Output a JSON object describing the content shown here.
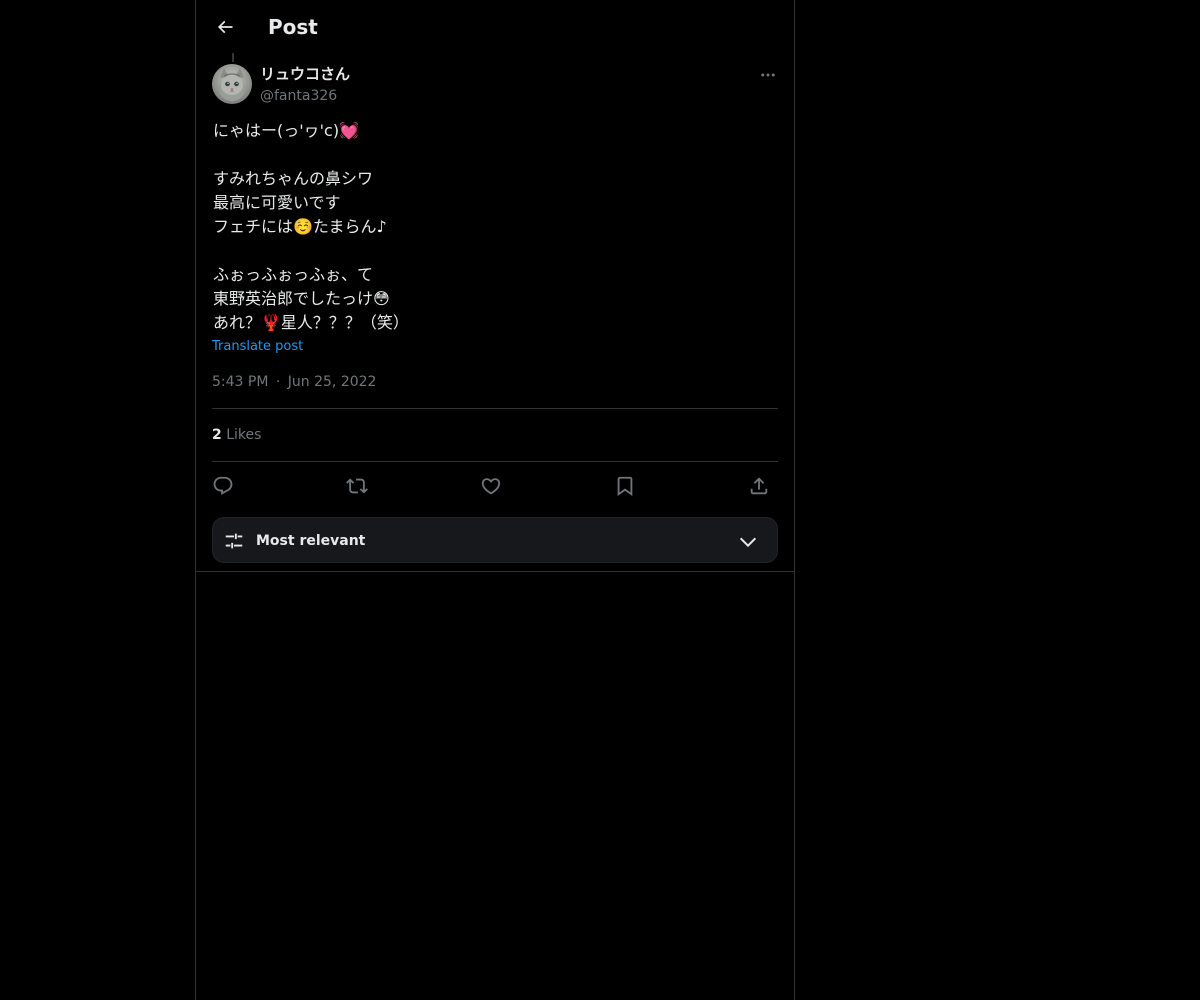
{
  "header": {
    "title": "Post",
    "back_icon": "back-arrow-icon"
  },
  "post": {
    "author": {
      "display_name": "リュウコさん",
      "handle": "@fanta326",
      "avatar_icon": "cat-avatar"
    },
    "text_lines": [
      "にゃはー(っ'ヮ'c)💓",
      "",
      "すみれちゃんの鼻シワ",
      "最高に可愛いです",
      "フェチには☺️たまらん♪",
      "",
      "ふぉっふぉっふぉ、て",
      "東野英治郎でしたっけ😳",
      "あれ？🦞星人？？？（笑）"
    ],
    "translate_label": "Translate post",
    "time": "5:43 PM",
    "separator": "·",
    "date": "Jun 25, 2022",
    "likes_count": "2",
    "likes_label": "Likes"
  },
  "actions": [
    {
      "name": "reply",
      "icon": "reply-icon"
    },
    {
      "name": "repost",
      "icon": "repost-icon"
    },
    {
      "name": "like",
      "icon": "heart-icon"
    },
    {
      "name": "bookmark",
      "icon": "bookmark-icon"
    },
    {
      "name": "share",
      "icon": "share-icon"
    }
  ],
  "sort": {
    "label": "Most relevant",
    "icon": "sliders-icon"
  },
  "colors": {
    "background": "#000000",
    "text_primary": "#e7e9ea",
    "text_secondary": "#71767b",
    "link": "#1d9bf0",
    "border": "#2f3336"
  }
}
